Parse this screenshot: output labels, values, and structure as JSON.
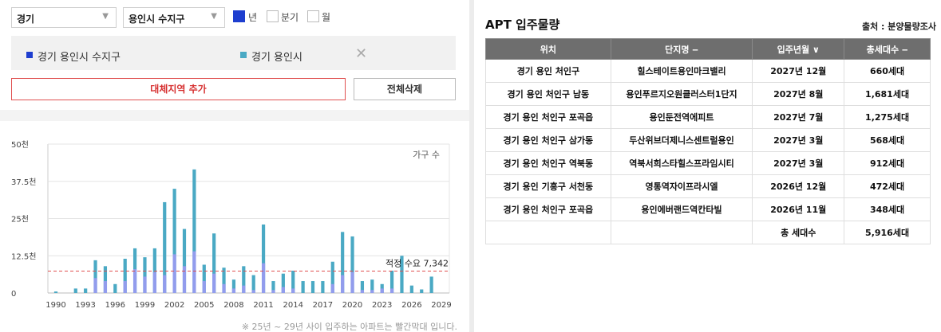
{
  "filters": {
    "province": "경기",
    "city": "용인시 수지구",
    "periods": [
      {
        "label": "년",
        "checked": true
      },
      {
        "label": "분기",
        "checked": false
      },
      {
        "label": "월",
        "checked": false
      }
    ]
  },
  "regions": [
    {
      "name": "경기 용인시 수지구",
      "color": "#1e3ecf"
    },
    {
      "name": "경기 용인시",
      "color": "#4aa9c4"
    }
  ],
  "buttons": {
    "add": "대체지역 추가",
    "delete_all": "전체삭제"
  },
  "note": "※ 25년 ~ 29년 사이 입주하는 아파트는 빨간막대 입니다.",
  "chart_data": {
    "type": "bar",
    "legend": "가구 수",
    "ylim": [
      0,
      50000
    ],
    "yticks": [
      {
        "v": 0,
        "label": "0"
      },
      {
        "v": 12500,
        "label": "12.5천"
      },
      {
        "v": 25000,
        "label": "25천"
      },
      {
        "v": 37500,
        "label": "37.5천"
      },
      {
        "v": 50000,
        "label": "50천"
      }
    ],
    "xticks": [
      "1990",
      "1993",
      "1996",
      "1999",
      "2002",
      "2005",
      "2008",
      "2011",
      "2014",
      "2017",
      "2020",
      "2023",
      "2026",
      "2029"
    ],
    "reference_line": {
      "value": 7342,
      "label": "적정 수요 7,342"
    },
    "x": [
      1990,
      1991,
      1992,
      1993,
      1994,
      1995,
      1996,
      1997,
      1998,
      1999,
      2000,
      2001,
      2002,
      2003,
      2004,
      2005,
      2006,
      2007,
      2008,
      2009,
      2010,
      2011,
      2012,
      2013,
      2014,
      2015,
      2016,
      2017,
      2018,
      2019,
      2020,
      2021,
      2022,
      2023,
      2024,
      2025,
      2026,
      2027,
      2028,
      2029
    ],
    "series": [
      {
        "name": "경기 용인시",
        "color": "#4aa9c4",
        "values": [
          500,
          0,
          1500,
          1500,
          11000,
          9000,
          3000,
          11500,
          15000,
          12000,
          15000,
          30500,
          35000,
          21500,
          41500,
          9500,
          20000,
          8500,
          4500,
          9000,
          6000,
          23000,
          4000,
          6500,
          7500,
          4000,
          4000,
          4000,
          10500,
          20500,
          19000,
          4000,
          4500,
          3000,
          7500,
          12500,
          2500,
          1200,
          5500,
          0
        ]
      },
      {
        "name": "경기 용인시 수지구",
        "color": "#9a9af2",
        "values": [
          0,
          0,
          0,
          0,
          5000,
          4000,
          0,
          4000,
          8000,
          5500,
          7000,
          6000,
          13000,
          9000,
          14000,
          4000,
          6500,
          3000,
          1500,
          2500,
          1000,
          10000,
          1000,
          2000,
          1500,
          0,
          0,
          0,
          3000,
          6000,
          7000,
          1000,
          1000,
          1500,
          1500,
          0,
          0,
          0,
          0,
          0
        ]
      }
    ]
  },
  "apt": {
    "title": "APT 입주물량",
    "source": "출처 : 분양물량조사",
    "headers": [
      "위치",
      "단지명 ‒",
      "입주년월 ∨",
      "총세대수 ‒"
    ],
    "rows": [
      [
        "경기 용인 처인구",
        "힐스테이트용인마크밸리",
        "2027년 12월",
        "660세대"
      ],
      [
        "경기 용인 처인구 남동",
        "용인푸르지오원클러스터1단지",
        "2027년 8월",
        "1,681세대"
      ],
      [
        "경기 용인 처인구 포곡읍",
        "용인둔전역에피트",
        "2027년 7월",
        "1,275세대"
      ],
      [
        "경기 용인 처인구 삼가동",
        "두산위브더제니스센트럴용인",
        "2027년 3월",
        "568세대"
      ],
      [
        "경기 용인 처인구 역북동",
        "역북서희스타힐스프라임시티",
        "2027년 3월",
        "912세대"
      ],
      [
        "경기 용인 기흥구 서천동",
        "영통역자이프라시엘",
        "2026년 12월",
        "472세대"
      ],
      [
        "경기 용인 처인구 포곡읍",
        "용인에버랜드역칸타빌",
        "2026년 11월",
        "348세대"
      ]
    ],
    "total_label": "총 세대수",
    "total_value": "5,916세대"
  }
}
